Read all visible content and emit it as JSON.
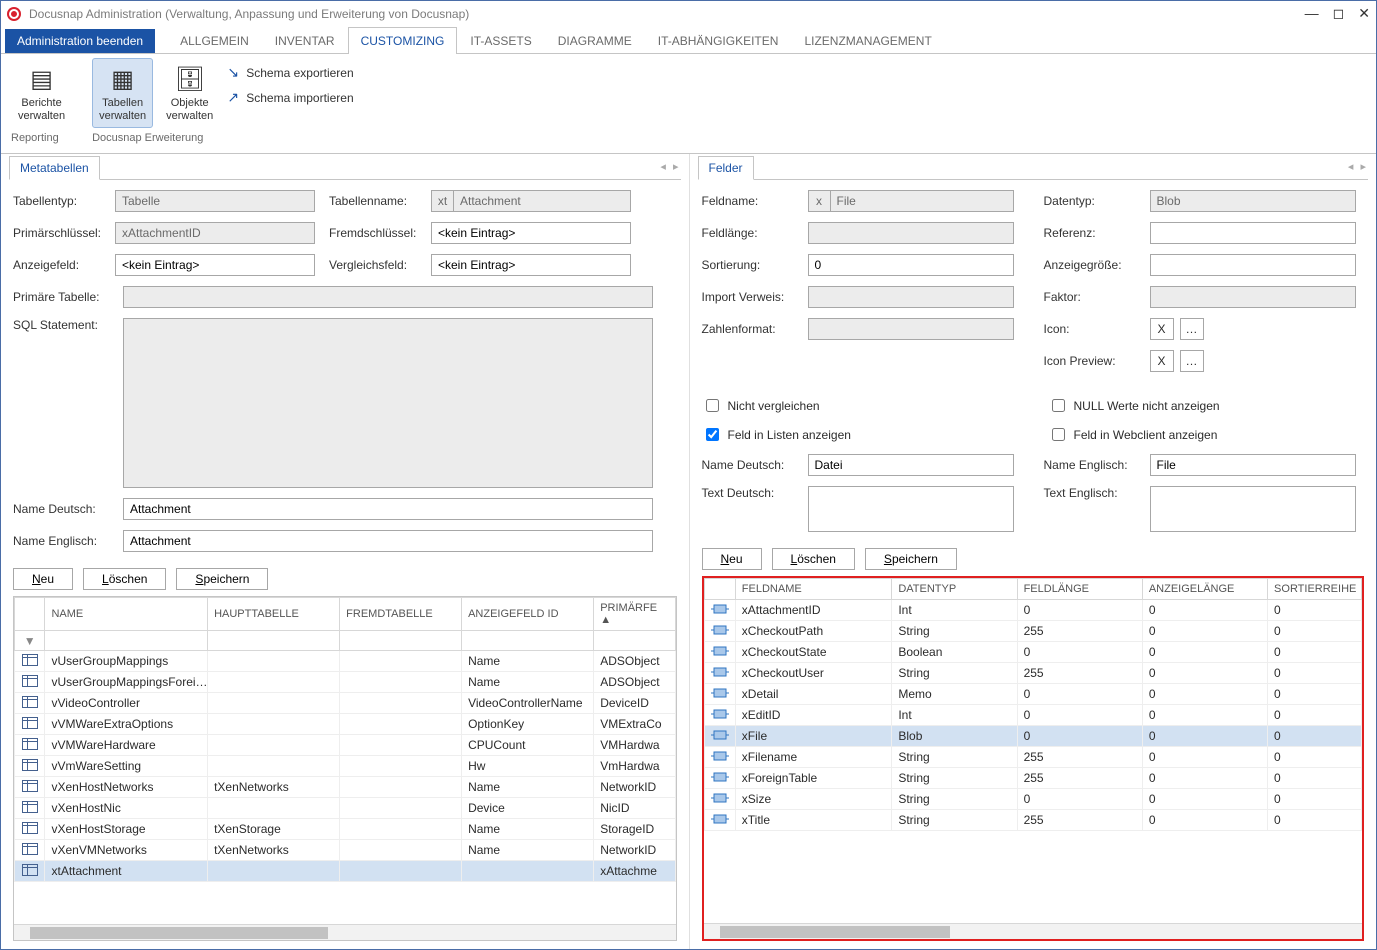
{
  "window": {
    "title": "Docusnap Administration (Verwaltung, Anpassung und Erweiterung von Docusnap)"
  },
  "tabs": {
    "end_admin": "Administration beenden",
    "items": [
      "ALLGEMEIN",
      "INVENTAR",
      "CUSTOMIZING",
      "IT-ASSETS",
      "DIAGRAMME",
      "IT-ABHÄNGIGKEITEN",
      "LIZENZMANAGEMENT"
    ],
    "active_index": 2
  },
  "ribbon": {
    "reporting_btn": "Berichte\nverwalten",
    "tables_btn": "Tabellen\nverwalten",
    "objects_btn": "Objekte\nverwalten",
    "schema_export": "Schema exportieren",
    "schema_import": "Schema importieren",
    "group_reporting": "Reporting",
    "group_ext": "Docusnap Erweiterung"
  },
  "left": {
    "tab": "Metatabellen",
    "labels": {
      "table_type": "Tabellentyp:",
      "pk": "Primärschlüssel:",
      "display": "Anzeigefeld:",
      "primary_table": "Primäre Tabelle:",
      "sql": "SQL Statement:",
      "tablename": "Tabellenname:",
      "fk": "Fremdschlüssel:",
      "cmp": "Vergleichsfeld:",
      "name_de": "Name Deutsch:",
      "name_en": "Name Englisch:"
    },
    "values": {
      "table_type": "Tabelle",
      "pk": "xAttachmentID",
      "display": "<kein Eintrag>",
      "tablename_prefix": "xt",
      "tablename": "Attachment",
      "fk": "<kein Eintrag>",
      "cmp": "<kein Eintrag>",
      "name_de": "Attachment",
      "name_en": "Attachment"
    },
    "buttons": {
      "new": "Neu",
      "delete": "Löschen",
      "save": "Speichern"
    },
    "grid": {
      "headers": [
        "NAME",
        "HAUPTTABELLE",
        "FREMDTABELLE",
        "ANZEIGEFELD ID",
        "PRIMÄRFE"
      ],
      "rows": [
        {
          "name": "vUserGroupMappings",
          "main": "",
          "for": "",
          "disp": "Name",
          "prim": "ADSObject"
        },
        {
          "name": "vUserGroupMappingsForei…",
          "main": "",
          "for": "",
          "disp": "Name",
          "prim": "ADSObject"
        },
        {
          "name": "vVideoController",
          "main": "",
          "for": "",
          "disp": "VideoControllerName",
          "prim": "DeviceID"
        },
        {
          "name": "vVMWareExtraOptions",
          "main": "",
          "for": "",
          "disp": "OptionKey",
          "prim": "VMExtraCo"
        },
        {
          "name": "vVMWareHardware",
          "main": "",
          "for": "",
          "disp": "CPUCount",
          "prim": "VMHardwa"
        },
        {
          "name": "vVmWareSetting",
          "main": "",
          "for": "",
          "disp": "Hw",
          "prim": "VmHardwa"
        },
        {
          "name": "vXenHostNetworks",
          "main": "tXenNetworks",
          "for": "",
          "disp": "Name",
          "prim": "NetworkID"
        },
        {
          "name": "vXenHostNic",
          "main": "",
          "for": "",
          "disp": "Device",
          "prim": "NicID"
        },
        {
          "name": "vXenHostStorage",
          "main": "tXenStorage",
          "for": "",
          "disp": "Name",
          "prim": "StorageID"
        },
        {
          "name": "vXenVMNetworks",
          "main": "tXenNetworks",
          "for": "",
          "disp": "Name",
          "prim": "NetworkID"
        },
        {
          "name": "xtAttachment",
          "main": "",
          "for": "",
          "disp": "",
          "prim": "xAttachme",
          "sel": true
        }
      ]
    }
  },
  "right": {
    "tab": "Felder",
    "labels": {
      "fieldname": "Feldname:",
      "datatype": "Datentyp:",
      "fieldlen": "Feldlänge:",
      "ref": "Referenz:",
      "sort": "Sortierung:",
      "dispsize": "Anzeigegröße:",
      "import": "Import Verweis:",
      "factor": "Faktor:",
      "numfmt": "Zahlenformat:",
      "icon": "Icon:",
      "iconprev": "Icon Preview:",
      "chk_nocmp": "Nicht vergleichen",
      "chk_nullhide": "NULL Werte nicht anzeigen",
      "chk_list": "Feld in Listen anzeigen",
      "chk_web": "Feld in Webclient anzeigen",
      "name_de": "Name Deutsch:",
      "name_en": "Name Englisch:",
      "text_de": "Text Deutsch:",
      "text_en": "Text Englisch:"
    },
    "values": {
      "fieldname_prefix": "x",
      "fieldname": "File",
      "datatype": "Blob",
      "sort": "0",
      "name_de": "Datei",
      "name_en": "File",
      "chk_list": true,
      "chk_nocmp": false,
      "chk_nullhide": false,
      "chk_web": false
    },
    "buttons": {
      "new": "Neu",
      "delete": "Löschen",
      "save": "Speichern"
    },
    "grid": {
      "headers": [
        "FELDNAME",
        "DATENTYP",
        "FELDLÄNGE",
        "ANZEIGELÄNGE",
        "SORTIERREIHE"
      ],
      "rows": [
        {
          "name": "xAttachmentID",
          "type": "Int",
          "len": "0",
          "disp": "0",
          "sort": "0"
        },
        {
          "name": "xCheckoutPath",
          "type": "String",
          "len": "255",
          "disp": "0",
          "sort": "0"
        },
        {
          "name": "xCheckoutState",
          "type": "Boolean",
          "len": "0",
          "disp": "0",
          "sort": "0"
        },
        {
          "name": "xCheckoutUser",
          "type": "String",
          "len": "255",
          "disp": "0",
          "sort": "0"
        },
        {
          "name": "xDetail",
          "type": "Memo",
          "len": "0",
          "disp": "0",
          "sort": "0"
        },
        {
          "name": "xEditID",
          "type": "Int",
          "len": "0",
          "disp": "0",
          "sort": "0"
        },
        {
          "name": "xFile",
          "type": "Blob",
          "len": "0",
          "disp": "0",
          "sort": "0",
          "sel": true
        },
        {
          "name": "xFilename",
          "type": "String",
          "len": "255",
          "disp": "0",
          "sort": "0"
        },
        {
          "name": "xForeignTable",
          "type": "String",
          "len": "255",
          "disp": "0",
          "sort": "0"
        },
        {
          "name": "xSize",
          "type": "String",
          "len": "0",
          "disp": "0",
          "sort": "0"
        },
        {
          "name": "xTitle",
          "type": "String",
          "len": "255",
          "disp": "0",
          "sort": "0"
        }
      ]
    }
  }
}
